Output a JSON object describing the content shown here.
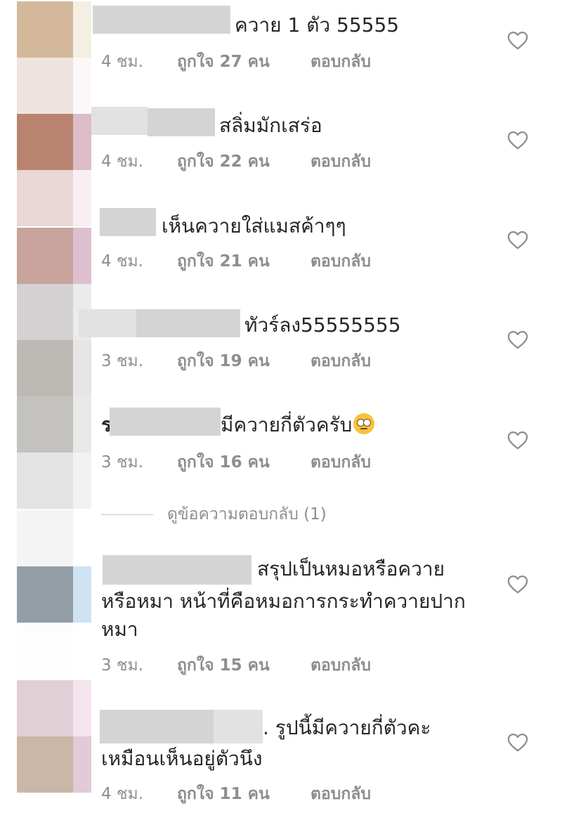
{
  "comments": [
    {
      "text": "ควาย 1 ตัว 55555",
      "time": "4 ชม.",
      "likes": "ถูกใจ 27 คน",
      "reply": "ตอบกลับ"
    },
    {
      "text": "สลิ่มมักเสร่อ",
      "time": "4 ชม.",
      "likes": "ถูกใจ 22 คน",
      "reply": "ตอบกลับ"
    },
    {
      "text": "เห็นควายใส่แมสค้าๆๆ",
      "time": "4 ชม.",
      "likes": "ถูกใจ 21 คน",
      "reply": "ตอบกลับ"
    },
    {
      "text": "ทัวร์ลง55555555",
      "time": "3 ชม.",
      "likes": "ถูกใจ 19 คน",
      "reply": "ตอบกลับ"
    },
    {
      "prefix": "ร",
      "text": "มีควายกี่ตัวครับ",
      "time": "3 ชม.",
      "likes": "ถูกใจ 16 คน",
      "reply": "ตอบกลับ"
    },
    {
      "line1": "สรุปเป็นหมอหรือควาย",
      "line2": "หรือหมา หน้าที่คือหมอการกระทำควายปาก",
      "line3": "หมา",
      "time": "3 ชม.",
      "likes": "ถูกใจ 15 คน",
      "reply": "ตอบกลับ"
    },
    {
      "line1": ". รูปนี้มีควายกี่ตัวคะ",
      "line2": "เหมือนเห็นอยู่ตัวนึง",
      "time": "4 ชม.",
      "likes": "ถูกใจ 11 คน",
      "reply": "ตอบกลับ"
    }
  ],
  "view_replies": "ดูข้อความตอบกลับ (1)",
  "icons": {
    "like": "heart-outline-icon",
    "emoji": "face-with-rolling-eyes-emoji"
  },
  "colors": {
    "text": "#262626",
    "meta": "#8e8e8e",
    "censor": "#d4d4d4",
    "icon": "#8e8e8e"
  }
}
